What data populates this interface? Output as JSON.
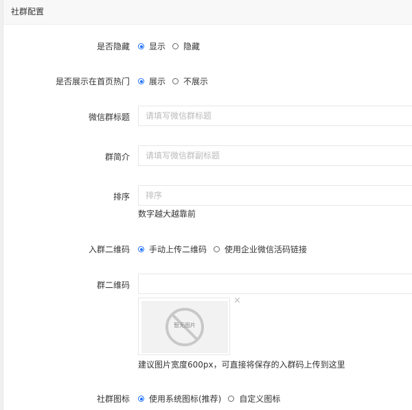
{
  "panel": {
    "title": "社群配置"
  },
  "fields": {
    "hidden": {
      "label": "是否隐藏",
      "options": [
        "显示",
        "隐藏"
      ],
      "selected": 0
    },
    "hot": {
      "label": "是否展示在首页热门",
      "options": [
        "展示",
        "不展示"
      ],
      "selected": 0
    },
    "group_title": {
      "label": "微信群标题",
      "value": "",
      "placeholder": "请填写微信群标题"
    },
    "group_intro": {
      "label": "群简介",
      "value": "",
      "placeholder": "请填写微信群副标题"
    },
    "sort": {
      "label": "排序",
      "value": "",
      "placeholder": "排序",
      "hint": "数字越大越靠前"
    },
    "qr_mode": {
      "label": "入群二维码",
      "options": [
        "手动上传二维码",
        "使用企业微信活码链接"
      ],
      "selected": 0
    },
    "qr_code": {
      "label": "群二维码",
      "value": "",
      "placeholder": "",
      "no_image_text": "暂无图片",
      "close_glyph": "×",
      "hint": "建议图片宽度600px，可直接将保存的入群码上传到这里"
    },
    "icon_mode": {
      "label": "社群图标",
      "options": [
        "使用系统图标(推荐)",
        "自定义图标"
      ],
      "selected": 0
    }
  },
  "colors": {
    "accent": "#1e6fff",
    "border": "#e6e6e6",
    "placeholder": "#bbbbbb"
  },
  "icons": {
    "no_image": "no-image-placeholder-icon",
    "close": "close-icon",
    "radio": "radio-icon"
  }
}
